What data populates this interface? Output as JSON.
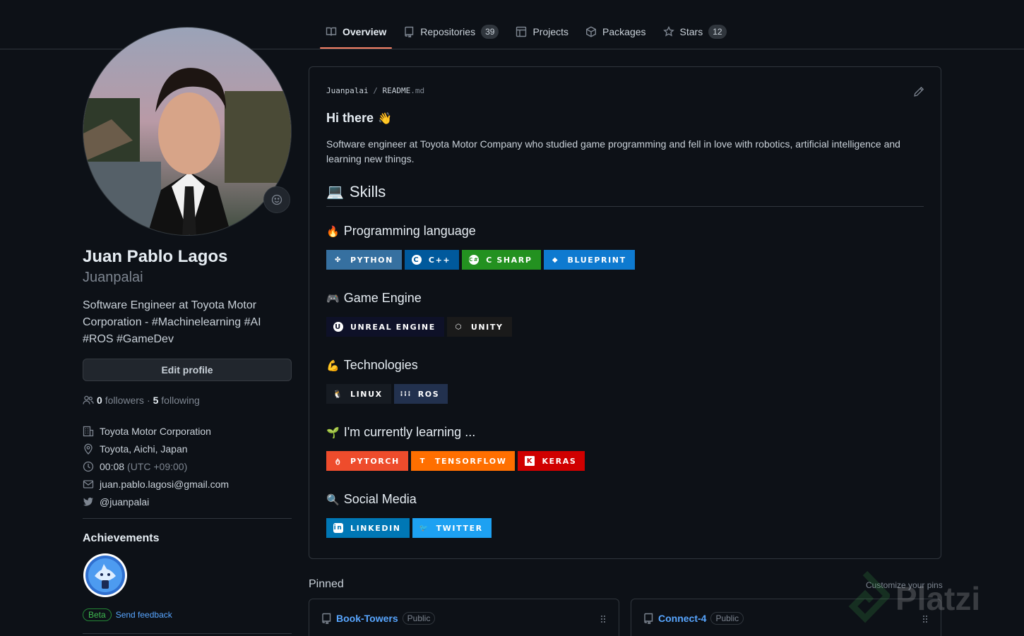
{
  "tabs": [
    {
      "label": "Overview",
      "icon": "book-icon"
    },
    {
      "label": "Repositories",
      "icon": "repo-icon",
      "count": "39"
    },
    {
      "label": "Projects",
      "icon": "project-table-icon"
    },
    {
      "label": "Packages",
      "icon": "package-icon"
    },
    {
      "label": "Stars",
      "icon": "star-icon",
      "count": "12"
    }
  ],
  "profile": {
    "full_name": "Juan Pablo Lagos",
    "username": "Juanpalai",
    "bio": "Software Engineer at Toyota Motor Corporation - #Machinelearning #AI #ROS #GameDev",
    "edit_label": "Edit profile",
    "followers_count": "0",
    "followers_label": "followers",
    "dot": "·",
    "following_count": "5",
    "following_label": "following",
    "company": "Toyota Motor Corporation",
    "location": "Toyota, Aichi, Japan",
    "time": "00:08",
    "timezone": "(UTC +09:00)",
    "email": "juan.pablo.lagosi@gmail.com",
    "twitter": "@juanpalai"
  },
  "achievements": {
    "title": "Achievements",
    "beta_label": "Beta",
    "feedback_label": "Send feedback"
  },
  "readme": {
    "owner": "Juanpalai",
    "slash": "/",
    "file": "README",
    "ext": ".md",
    "greeting": "Hi there",
    "intro": "Software engineer at Toyota Motor Company who studied game programming and fell in love with robotics, artificial intelligence and learning new things.",
    "skills_heading": "Skills",
    "sections": [
      {
        "title": "Programming language",
        "emoji": "🔥",
        "badges": [
          {
            "label": "PYTHON",
            "color": "#3670A0",
            "icon": "python-icon",
            "glyph": "✤"
          },
          {
            "label": "C++",
            "color": "#00599C",
            "icon": "cplusplus-icon",
            "glyph": "C"
          },
          {
            "label": "C SHARP",
            "color": "#239120",
            "icon": "csharp-icon",
            "glyph": "C#"
          },
          {
            "label": "BLUEPRINT",
            "color": "#0E7AD0",
            "icon": "blueprint-icon",
            "glyph": "◆"
          }
        ]
      },
      {
        "title": "Game Engine",
        "emoji": "🎮",
        "badges": [
          {
            "label": "UNREAL ENGINE",
            "color": "#0E1128",
            "icon": "unreal-icon",
            "glyph": "U"
          },
          {
            "label": "UNITY",
            "color": "#1a1a1a",
            "icon": "unity-icon",
            "glyph": "⬡"
          }
        ]
      },
      {
        "title": "Technologies",
        "emoji": "💪",
        "badges": [
          {
            "label": "LINUX",
            "color": "#161b22",
            "icon": "linux-icon",
            "glyph": "🐧"
          },
          {
            "label": "ROS",
            "color": "#22314E",
            "icon": "ros-icon",
            "glyph": "⁞⁞⁞"
          }
        ]
      },
      {
        "title": "I'm currently learning ...",
        "emoji": "🌱",
        "badges": [
          {
            "label": "PYTORCH",
            "color": "#EE4C2C",
            "icon": "pytorch-icon",
            "glyph": "ტ"
          },
          {
            "label": "TENSORFLOW",
            "color": "#FF6F00",
            "icon": "tensorflow-icon",
            "glyph": "T"
          },
          {
            "label": "KERAS",
            "color": "#D00000",
            "icon": "keras-icon",
            "glyph": "K"
          }
        ]
      },
      {
        "title": "Social Media",
        "emoji": "🔍",
        "badges": [
          {
            "label": "LINKEDIN",
            "color": "#0077B5",
            "icon": "linkedin-icon",
            "glyph": "in"
          },
          {
            "label": "TWITTER",
            "color": "#1DA1F2",
            "icon": "twitter-bird-icon",
            "glyph": "🐦"
          }
        ]
      }
    ]
  },
  "pinned": {
    "title": "Pinned",
    "customize_label": "Customize your pins",
    "repos": [
      {
        "name": "Book-Towers",
        "visibility": "Public"
      },
      {
        "name": "Connect-4",
        "visibility": "Public"
      }
    ]
  },
  "watermark": "Platzi",
  "colors": {
    "accent_tab_underline": "#f78166",
    "link": "#58a6ff",
    "background": "#0d1117"
  }
}
